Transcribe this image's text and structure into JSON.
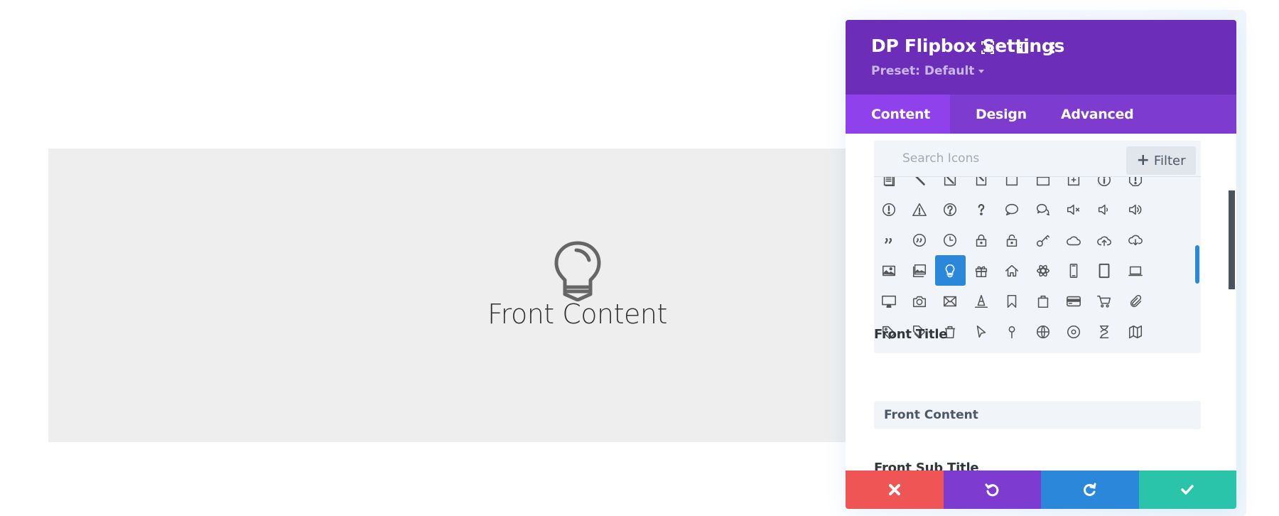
{
  "preview": {
    "icon": "lightbulb-icon",
    "title": "Front Content"
  },
  "panel": {
    "title": "DP Flipbox Settings",
    "preset_label": "Preset: Default",
    "header_icons": [
      "expand-icon",
      "split-view-icon",
      "more-vertical-icon"
    ],
    "tabs": [
      {
        "label": "Content",
        "active": true
      },
      {
        "label": "Design",
        "active": false
      },
      {
        "label": "Advanced",
        "active": false
      }
    ],
    "icon_picker": {
      "search_placeholder": "Search Icons",
      "search_value": "",
      "filter_label": "Filter",
      "selected_icon": "lightbulb",
      "rows": [
        [
          "document",
          "pencil",
          "edit-box",
          "edit-corner",
          "frame",
          "window",
          "add-box",
          "info-circle",
          "alert-octagon"
        ],
        [
          "alert-circle",
          "warning-triangle",
          "help-circle",
          "question",
          "chat-bubble",
          "chat-bubbles",
          "volume-mute",
          "volume-low",
          "volume-high"
        ],
        [
          "quote",
          "quote-circle",
          "clock",
          "lock",
          "unlock",
          "key",
          "cloud",
          "cloud-upload",
          "cloud-download"
        ],
        [
          "image",
          "images",
          "lightbulb",
          "gift",
          "home",
          "atom",
          "phone",
          "tablet",
          "laptop"
        ],
        [
          "desktop",
          "camera",
          "mail",
          "cone",
          "bookmark",
          "shopping-bag",
          "credit-card",
          "cart",
          "paperclip"
        ],
        [
          "tag",
          "tags",
          "trash",
          "pointer",
          "pin",
          "globe",
          "target",
          "hourglass",
          "map"
        ]
      ]
    },
    "fields": {
      "front_title_label": "Front Title",
      "front_title_value": "Front Content",
      "front_subtitle_label": "Front Sub Title"
    },
    "actions": [
      {
        "name": "discard",
        "icon": "close-icon",
        "color": "#ef5555"
      },
      {
        "name": "undo",
        "icon": "undo-icon",
        "color": "#7e3bd0"
      },
      {
        "name": "redo",
        "icon": "redo-icon",
        "color": "#2b87da"
      },
      {
        "name": "save",
        "icon": "check-icon",
        "color": "#29c4a9"
      }
    ]
  },
  "colors": {
    "header": "#6c2eb9",
    "tabs": "#7e3bd0",
    "tab_active": "#8f42ec",
    "selected": "#2b87da",
    "preview_bg": "#eeeeee"
  }
}
